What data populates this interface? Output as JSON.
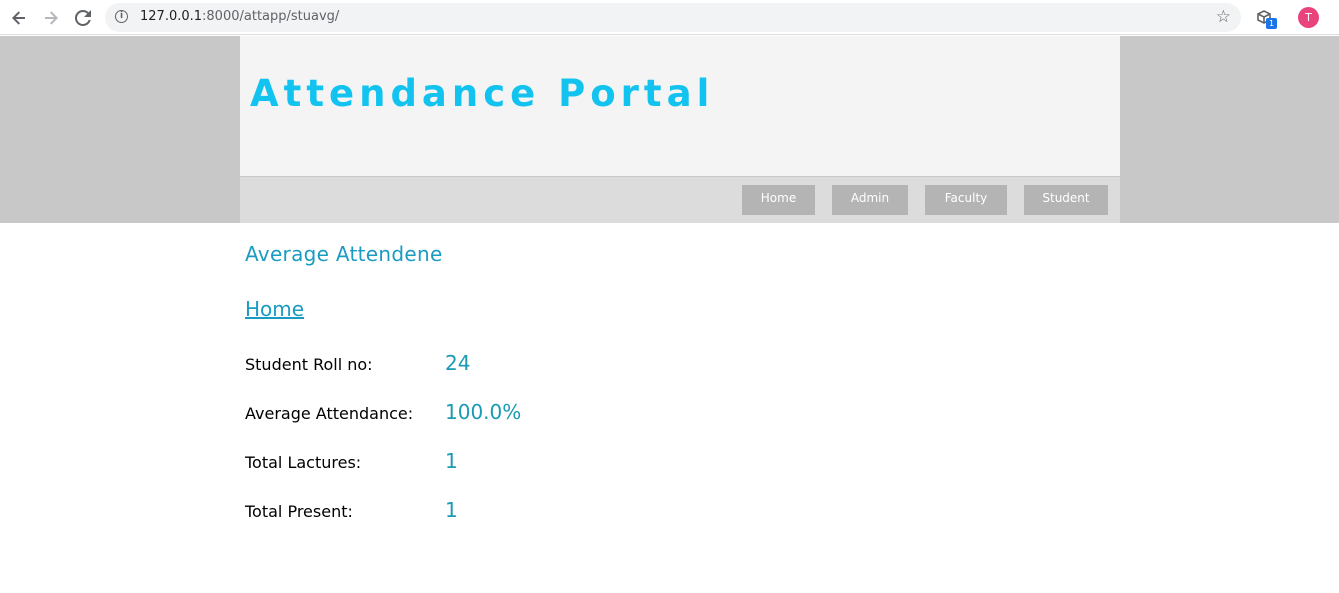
{
  "browser": {
    "url_host": "127.0.0.1",
    "url_rest": ":8000/attapp/stuavg/",
    "icons": {
      "back": "back-arrow-icon",
      "forward": "forward-arrow-icon",
      "reload": "reload-icon",
      "info": "info-icon",
      "bookmark": "star-icon",
      "extension": "extension-icon"
    },
    "extension_badge": "1",
    "avatar_initial": "T"
  },
  "header": {
    "site_title": "Attendance Portal",
    "nav": [
      {
        "label": "Home"
      },
      {
        "label": "Admin"
      },
      {
        "label": "Faculty"
      },
      {
        "label": "Student"
      }
    ]
  },
  "main": {
    "heading": "Average Attendene",
    "home_link": "Home",
    "rows": [
      {
        "label": "Student Roll no:",
        "value": "24"
      },
      {
        "label": "Average Attendance:",
        "value": "100.0%"
      },
      {
        "label": "Total Lactures:",
        "value": "1"
      },
      {
        "label": "Total Present:",
        "value": "1"
      }
    ]
  },
  "colors": {
    "title": "#13c3ef",
    "accent": "#1a9bc1",
    "value": "#1b9ab3",
    "header_band": "#c8c8c8",
    "menu_button": "#b4b4b4",
    "avatar": "#e8437c"
  }
}
